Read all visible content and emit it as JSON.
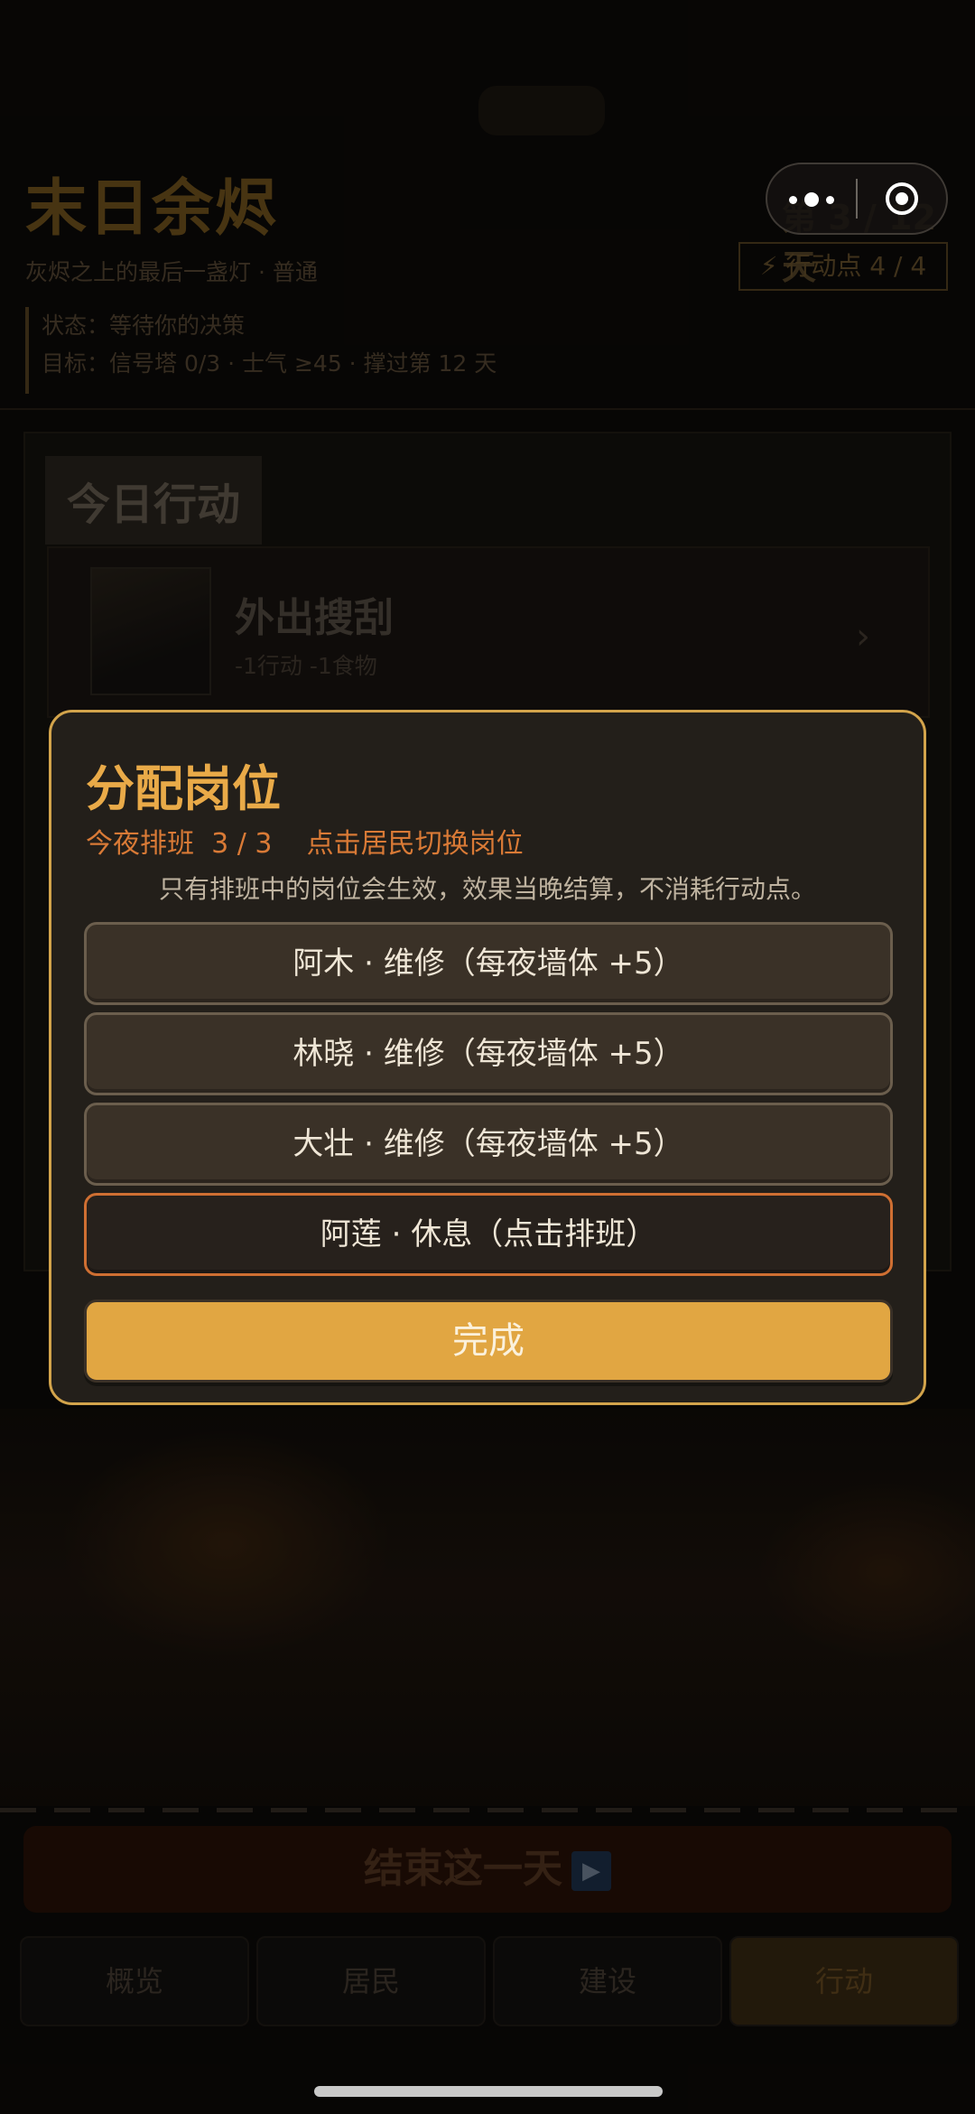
{
  "game": {
    "title": "末日余烬",
    "subtitle": "灰烬之上的最后一盏灯 · 普通",
    "day": "第 3 / 12 天",
    "action_points": "⚡ 行动点 4 / 4",
    "status": "状态：等待你的决策",
    "goal": "目标：信号塔 0/3 · 士气 ≥45 · 撑过第 12 天"
  },
  "actions": {
    "heading": "今日行动",
    "card": {
      "name": "外出搜刮",
      "cost": "-1行动  -1食物"
    }
  },
  "end_day": {
    "label": "结束这一天",
    "icon": "▶"
  },
  "tabs": [
    {
      "label": "概览"
    },
    {
      "label": "居民"
    },
    {
      "label": "建设"
    },
    {
      "label": "行动",
      "active": true
    }
  ],
  "modal": {
    "title": "分配岗位",
    "info": "今夜排班  3 / 3    点击居民切换岗位",
    "note": "只有排班中的岗位会生效，效果当晚结算，不消耗行动点。",
    "assignments": [
      {
        "label": "阿木 · 维修（每夜墙体 +5）",
        "state": "assigned"
      },
      {
        "label": "林晓 · 维修（每夜墙体 +5）",
        "state": "assigned"
      },
      {
        "label": "大壮 · 维修（每夜墙体 +5）",
        "state": "assigned"
      },
      {
        "label": "阿莲 · 休息（点击排班）",
        "state": "idle"
      }
    ],
    "done_label": "完成"
  },
  "colors": {
    "accent": "#e1a642",
    "modal_border": "#d3a44b",
    "idle_border": "#cf6f32",
    "title": "#e9aa48"
  }
}
